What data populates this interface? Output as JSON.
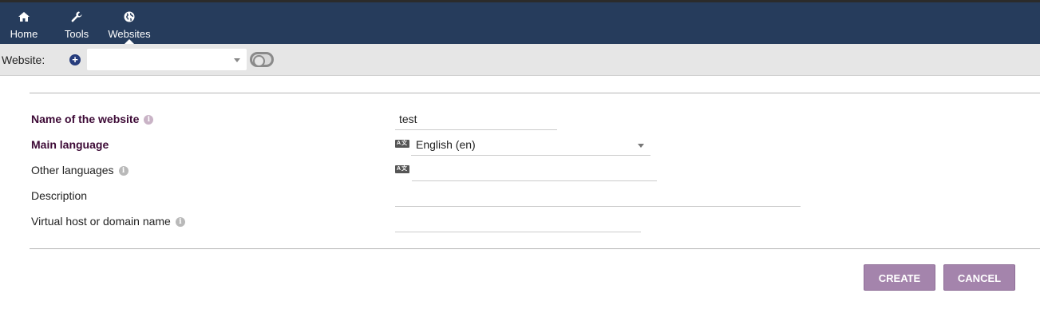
{
  "nav": {
    "items": [
      {
        "label": "Home",
        "icon": "home-icon"
      },
      {
        "label": "Tools",
        "icon": "wrench-icon"
      },
      {
        "label": "Websites",
        "icon": "globe-icon",
        "active": true
      }
    ]
  },
  "website_bar": {
    "label": "Website:",
    "selected": ""
  },
  "form": {
    "name": {
      "label": "Name of the website",
      "value": "test"
    },
    "main_language": {
      "label": "Main language",
      "value": "English (en)"
    },
    "other_languages": {
      "label": "Other languages",
      "value": ""
    },
    "description": {
      "label": "Description",
      "value": ""
    },
    "virtual_host": {
      "label": "Virtual host or domain name",
      "value": ""
    }
  },
  "buttons": {
    "create": "CREATE",
    "cancel": "CANCEL"
  },
  "colors": {
    "topbar": "#263c5c",
    "required_label": "#3d0a36",
    "button": "#a484ac"
  }
}
